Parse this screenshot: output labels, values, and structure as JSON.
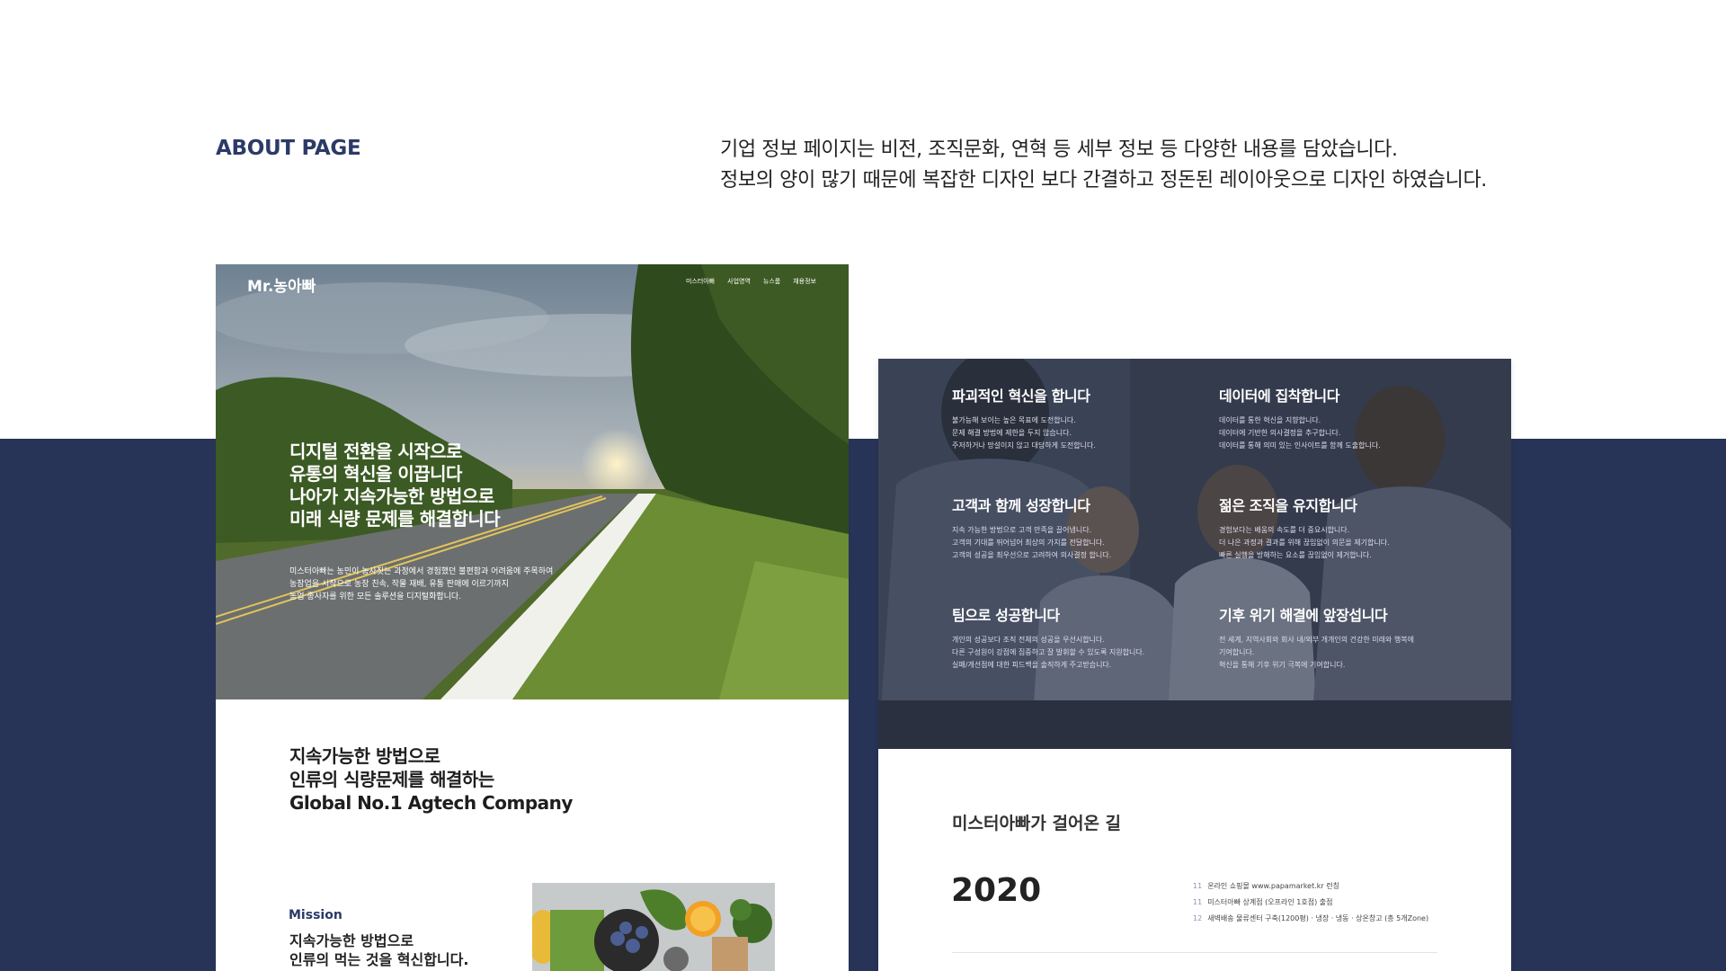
{
  "section": {
    "title": "ABOUT PAGE",
    "description": [
      "기업 정보 페이지는 비전, 조직문화, 연혁 등 세부 정보 등 다양한 내용를 담았습니다.",
      "정보의 양이 많기 때문에 복잡한 디자인 보다 간결하고 정돈된 레이아웃으로 디자인 하였습니다."
    ]
  },
  "left_mockup": {
    "logo": "Mr.농아빠",
    "nav": [
      "미스터아빠",
      "사업영역",
      "뉴스룸",
      "채용정보"
    ],
    "hero_headline": [
      "디지털 전환을 시작으로",
      "유통의 혁신을 이끕니다",
      "나아가 지속가능한 방법으로",
      "미래 식량 문제를 해결합니다"
    ],
    "hero_sub": [
      "미스터아빠는 농민이 농사짓는 과정에서 경험했던 불편함과 어려움에 주목하여",
      "농장업을 시작으로 농장 친속, 작물 재배, 유통 판매에 이르기까지",
      "농업 종사자를 위한 모든 솔루션을 디지털화합니다."
    ],
    "company_title": [
      "지속가능한 방법으로",
      "인류의 식량문제를 해결하는",
      "Global No.1 Agtech Company"
    ],
    "mission_label": "Mission",
    "mission_text": [
      "지속가능한 방법으로",
      "인류의 먹는 것을 혁신합니다."
    ]
  },
  "right_mockup": {
    "values": [
      {
        "title": "파괴적인 혁신을 합니다",
        "lines": [
          "불가능해 보이는 높은 목표에 도전합니다.",
          "문제 해결 방법에 제한을 두지 않습니다.",
          "주저하거나 망설이지 않고 대담하게 도전합니다."
        ]
      },
      {
        "title": "데이터에 집착합니다",
        "lines": [
          "데이터를 통한 혁신을 지향합니다.",
          "데이터에 기반한 의사결정을 추구합니다.",
          "데이터를 통해 의미 있는 인사이트를 함께 도출합니다."
        ]
      },
      {
        "title": "고객과 함께 성장합니다",
        "lines": [
          "지속 가능한 방법으로 고객 만족을 끌어냅니다.",
          "고객의 기대를 뛰어넘어 최상의 가치를 전달합니다.",
          "고객의 성공을 최우선으로 고려하여 의사결정 합니다."
        ]
      },
      {
        "title": "젊은 조직을 유지합니다",
        "lines": [
          "경험보다는 배움의 속도를 더 중요시합니다.",
          "더 나은 과정과 결과를 위해 끊임없이 의문을 제기합니다.",
          "빠른 실행을 방해하는 요소를 끊임없이 제거합니다."
        ]
      },
      {
        "title": "팀으로 성공합니다",
        "lines": [
          "개인의 성공보다 조직 전체의 성공을 우선시합니다.",
          "다른 구성원이 강점에 집중하고 잘 발휘할 수 있도록 지원합니다.",
          "실패/개선점에 대한 피드백을 솔직하게 주고받습니다."
        ]
      },
      {
        "title": "기후 위기 해결에 앞장섭니다",
        "lines": [
          "전 세계, 지역사회와 회사 내/외부 개개인의 건강한 미래와 행복에",
          "기여합니다.",
          "혁신을 통해 기후 위기 극복에 기여합니다."
        ]
      }
    ],
    "history_title": "미스터아빠가 걸어온 길",
    "history_year": "2020",
    "history_events": [
      {
        "month": "11",
        "text": "온라인 쇼핑몰 www.papamarket.kr 런칭"
      },
      {
        "month": "11",
        "text": "미스터아빠 상계점 (오프라인 1호점) 출점"
      },
      {
        "month": "12",
        "text": "새벽배송 물류센터 구축(1200평) · 냉장 · 냉동 · 상온창고 (총 5개Zone)"
      }
    ]
  },
  "colors": {
    "navy": "#283457",
    "accent_text": "#2b3a67"
  }
}
